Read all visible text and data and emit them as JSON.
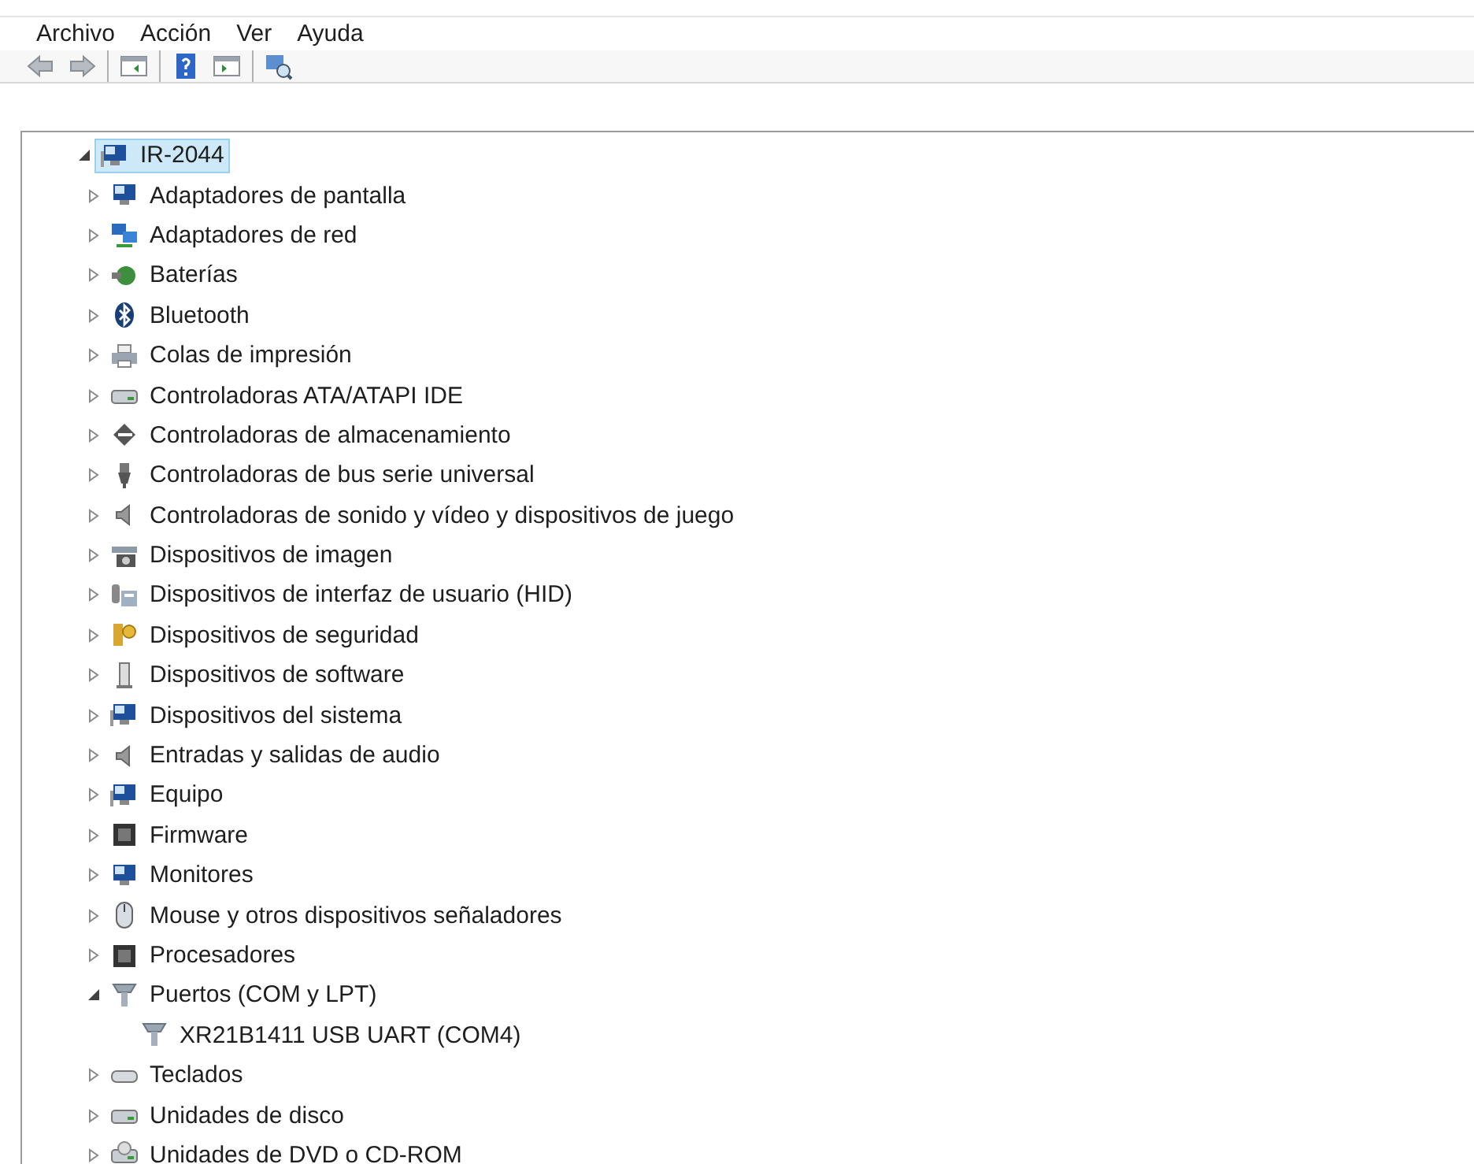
{
  "menu": [
    {
      "label": "Archivo"
    },
    {
      "label": "Acción"
    },
    {
      "label": "Ver"
    },
    {
      "label": "Ayuda"
    }
  ],
  "tree": {
    "label": "IR-2044",
    "expanded": true,
    "selected": true,
    "children": [
      {
        "label": "Adaptadores de pantalla",
        "expanded": false,
        "selected": false
      },
      {
        "label": "Adaptadores de red",
        "expanded": false,
        "selected": false
      },
      {
        "label": "Baterías",
        "expanded": false,
        "selected": false
      },
      {
        "label": "Bluetooth",
        "expanded": false,
        "selected": false
      },
      {
        "label": "Colas de impresión",
        "expanded": false,
        "selected": false
      },
      {
        "label": "Controladoras ATA/ATAPI IDE",
        "expanded": false,
        "selected": false
      },
      {
        "label": "Controladoras de almacenamiento",
        "expanded": false,
        "selected": false
      },
      {
        "label": "Controladoras de bus serie universal",
        "expanded": false,
        "selected": false
      },
      {
        "label": "Controladoras de sonido y vídeo y dispositivos de juego",
        "expanded": false,
        "selected": false
      },
      {
        "label": "Dispositivos de imagen",
        "expanded": false,
        "selected": false
      },
      {
        "label": "Dispositivos de interfaz de usuario (HID)",
        "expanded": false,
        "selected": false
      },
      {
        "label": "Dispositivos de seguridad",
        "expanded": false,
        "selected": false
      },
      {
        "label": "Dispositivos de software",
        "expanded": false,
        "selected": false
      },
      {
        "label": "Dispositivos del sistema",
        "expanded": false,
        "selected": false
      },
      {
        "label": "Entradas y salidas de audio",
        "expanded": false,
        "selected": false
      },
      {
        "label": "Equipo",
        "expanded": false,
        "selected": false
      },
      {
        "label": "Firmware",
        "expanded": false,
        "selected": false
      },
      {
        "label": "Monitores",
        "expanded": false,
        "selected": false
      },
      {
        "label": "Mouse y otros dispositivos señaladores",
        "expanded": false,
        "selected": false
      },
      {
        "label": "Procesadores",
        "expanded": false,
        "selected": false
      },
      {
        "label": "Puertos (COM y LPT)",
        "expanded": true,
        "selected": false,
        "children": [
          {
            "label": "XR21B1411 USB UART (COM4)",
            "selected": false
          }
        ]
      },
      {
        "label": "Teclados",
        "expanded": false,
        "selected": false
      },
      {
        "label": "Unidades de disco",
        "expanded": false,
        "selected": false
      },
      {
        "label": "Unidades de DVD o CD-ROM",
        "expanded": false,
        "selected": false
      }
    ]
  }
}
